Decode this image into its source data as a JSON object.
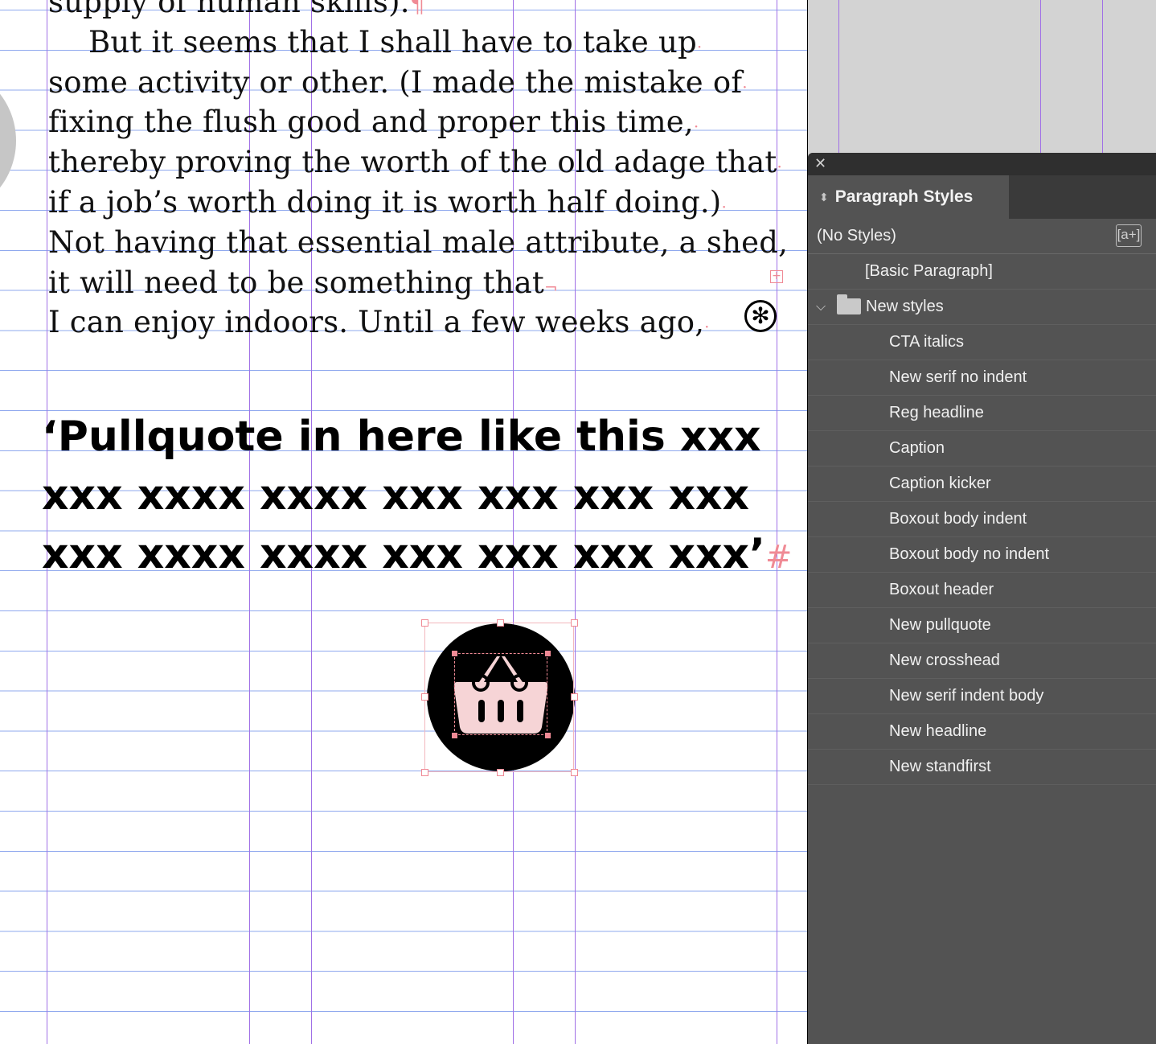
{
  "document": {
    "body_lines": [
      {
        "text": "supply of human skills).",
        "end": "¶",
        "indent": false
      },
      {
        "text": "But it seems that I shall have to take up",
        "end": "·",
        "indent": true
      },
      {
        "text": "some activity or other. (I made the mistake of",
        "end": "·",
        "indent": false
      },
      {
        "text": "fixing the flush good and proper this time,",
        "end": "·",
        "indent": false
      },
      {
        "text": "thereby proving the worth of the old adage that",
        "end": "·",
        "indent": false
      },
      {
        "text": "if a job’s worth doing it is worth half doing.)",
        "end": "·",
        "indent": false
      },
      {
        "text": "Not having that essential male attribute, a shed,",
        "end": "",
        "indent": false
      },
      {
        "text": "it will need to be something that",
        "end": "¬",
        "indent": false
      },
      {
        "text": "I can enjoy indoors. Until a few weeks ago,",
        "end": "·",
        "indent": false
      }
    ],
    "pullquote_lines": [
      "‘Pullquote in here like this xxx",
      "xxx xxxx xxxx xxx xxx xxx xxx",
      "xxx xxxx xxxx xxx xxx xxx xxx’"
    ],
    "pullquote_end_marker": "#",
    "overset_marker": "+",
    "anchor_icon": "asterisk-anchor-icon",
    "graphic_icon": "shopping-basket-icon"
  },
  "colors": {
    "guide_vertical": "#a070e6",
    "baseline_grid": "#8fa8ee",
    "hidden_chars": "#f08a95",
    "basket_fill": "#f6d4d6",
    "panel_bg": "#535353"
  },
  "panel": {
    "title": "Paragraph Styles",
    "close_label": "✕",
    "no_styles_label": "(No Styles)",
    "new_style_button_label": "[a+]",
    "basic_paragraph": "[Basic Paragraph]",
    "group_name": "New styles",
    "styles": [
      "CTA italics",
      "New serif no indent",
      "Reg headline",
      "Caption",
      "Caption kicker",
      "Boxout body indent",
      "Boxout body no indent",
      "Boxout header",
      "New pullquote",
      "New crosshead",
      "New serif indent body",
      "New headline",
      "New standfirst"
    ]
  }
}
